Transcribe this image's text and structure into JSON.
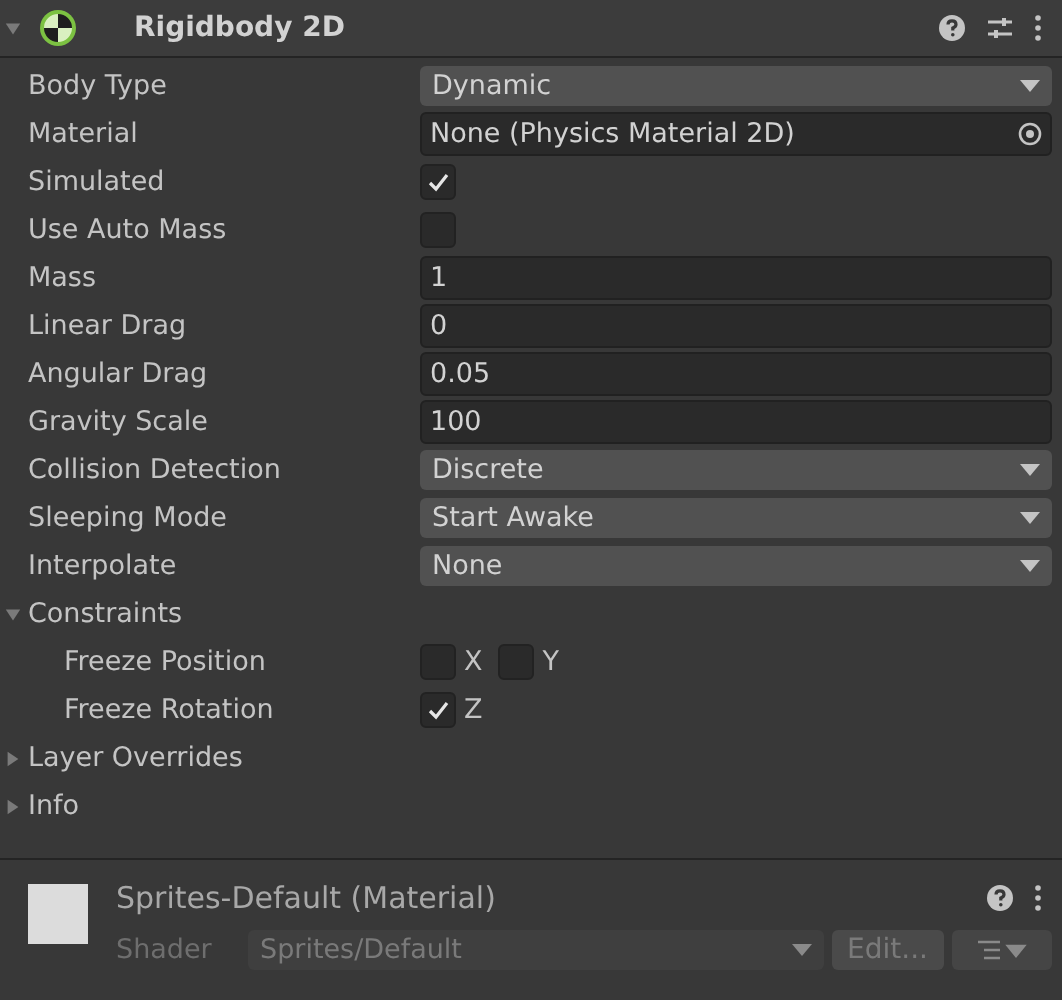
{
  "component": {
    "title": "Rigidbody 2D",
    "expanded": true
  },
  "properties": [
    {
      "kind": "dropdown",
      "label": "Body Type",
      "value": "Dynamic"
    },
    {
      "kind": "object",
      "label": "Material",
      "value": "None (Physics Material 2D)"
    },
    {
      "kind": "checkbox",
      "label": "Simulated",
      "checked": true
    },
    {
      "kind": "checkbox",
      "label": "Use Auto Mass",
      "checked": false
    },
    {
      "kind": "number",
      "label": "Mass",
      "value": "1"
    },
    {
      "kind": "number",
      "label": "Linear Drag",
      "value": "0"
    },
    {
      "kind": "number",
      "label": "Angular Drag",
      "value": "0.05"
    },
    {
      "kind": "number",
      "label": "Gravity Scale",
      "value": "100"
    },
    {
      "kind": "dropdown",
      "label": "Collision Detection",
      "value": "Discrete"
    },
    {
      "kind": "dropdown",
      "label": "Sleeping Mode",
      "value": "Start Awake"
    },
    {
      "kind": "dropdown",
      "label": "Interpolate",
      "value": "None"
    },
    {
      "kind": "foldout",
      "label": "Constraints",
      "expanded": true,
      "children": [
        {
          "label": "Freeze Position",
          "toggles": [
            {
              "axis": "X",
              "checked": false
            },
            {
              "axis": "Y",
              "checked": false
            }
          ]
        },
        {
          "label": "Freeze Rotation",
          "toggles": [
            {
              "axis": "Z",
              "checked": true
            }
          ]
        }
      ]
    },
    {
      "kind": "foldout",
      "label": "Layer Overrides",
      "expanded": false
    },
    {
      "kind": "foldout",
      "label": "Info",
      "expanded": false
    }
  ],
  "material": {
    "title": "Sprites-Default (Material)",
    "shader_label": "Shader",
    "shader": "Sprites/Default",
    "edit_button": "Edit...",
    "disabled": true
  }
}
